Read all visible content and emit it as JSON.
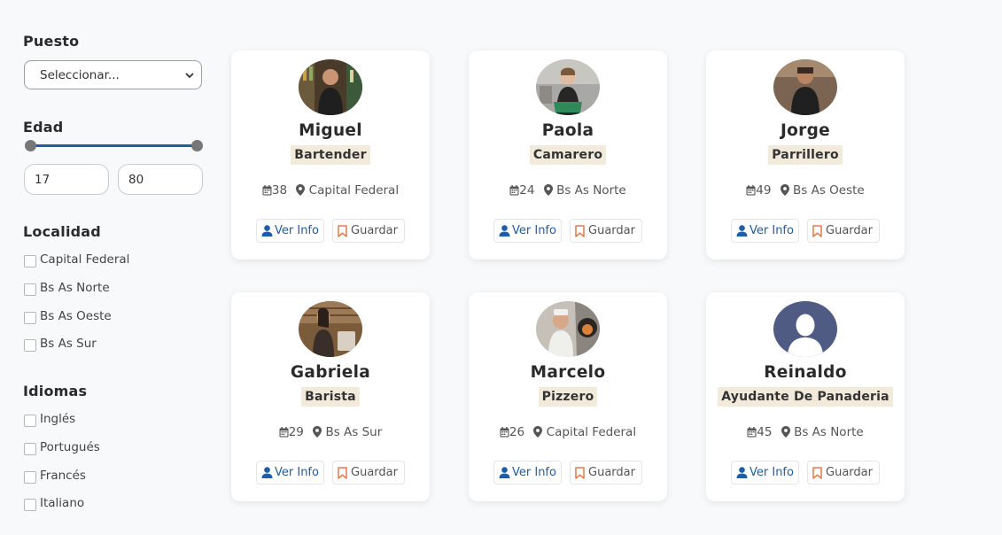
{
  "filters": {
    "puesto": {
      "title": "Puesto",
      "selected": "Seleccionar..."
    },
    "edad": {
      "title": "Edad",
      "min": "17",
      "max": "80"
    },
    "localidad": {
      "title": "Localidad",
      "options": [
        "Capital Federal",
        "Bs As Norte",
        "Bs As Oeste",
        "Bs As Sur"
      ]
    },
    "idiomas": {
      "title": "Idiomas",
      "options": [
        "Inglés",
        "Portugués",
        "Francés",
        "Italiano"
      ]
    }
  },
  "buttons": {
    "info": "Ver Info",
    "save": "Guardar"
  },
  "colors": {
    "accent": "#1d5ea8",
    "save_icon": "#e07a4a",
    "role_bg": "#f2ebdc"
  },
  "cards": [
    {
      "name": "Miguel",
      "role": "Bartender",
      "age": "38",
      "location": "Capital Federal",
      "photo": "bartender-photo"
    },
    {
      "name": "Paola",
      "role": "Camarero",
      "age": "24",
      "location": "Bs As Norte",
      "photo": "waitress-photo"
    },
    {
      "name": "Jorge",
      "role": "Parrillero",
      "age": "49",
      "location": "Bs As Oeste",
      "photo": "grill-chef-photo"
    },
    {
      "name": "Gabriela",
      "role": "Barista",
      "age": "29",
      "location": "Bs As Sur",
      "photo": "barista-photo"
    },
    {
      "name": "Marcelo",
      "role": "Pizzero",
      "age": "26",
      "location": "Capital Federal",
      "photo": "pizza-chef-photo"
    },
    {
      "name": "Reinaldo",
      "role": "Ayudante De Panaderia",
      "age": "45",
      "location": "Bs As Norte",
      "photo": "default-avatar-icon"
    }
  ]
}
